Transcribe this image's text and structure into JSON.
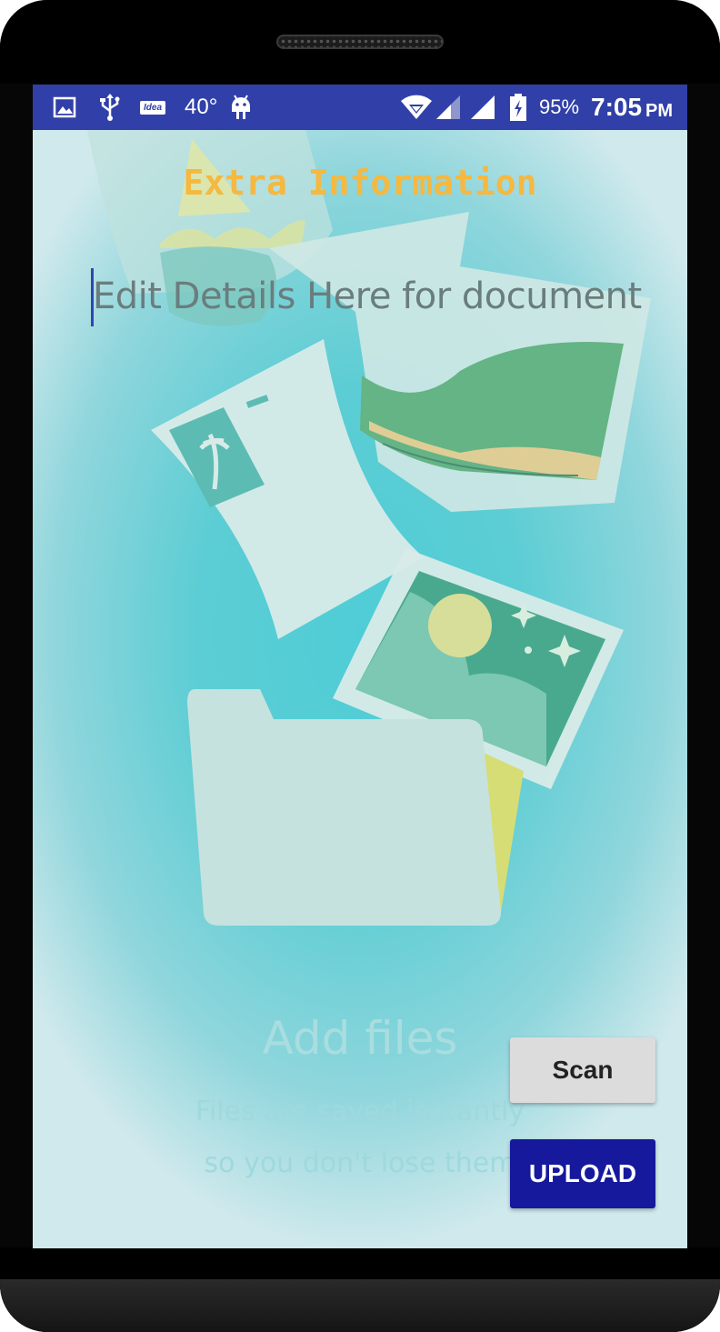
{
  "status_bar": {
    "temperature": "40°",
    "carrier_badge": "Idea",
    "battery_percent": "95%",
    "time": "7:05",
    "time_suffix": "PM",
    "icons": [
      "gallery-icon",
      "usb-icon",
      "idea-carrier-icon",
      "android-icon",
      "wifi-icon",
      "signal-icon",
      "signal-icon",
      "battery-charging-icon"
    ]
  },
  "screen": {
    "title": "Extra Information",
    "details_placeholder": "Edit Details Here for  document",
    "empty_state": {
      "title": "Add files",
      "subtitle_line1": "Files are saved instantly",
      "subtitle_line2": "so you don't lose them"
    },
    "scan_label": "Scan",
    "upload_label": "UPLOAD"
  },
  "colors": {
    "status_bar": "#3140a8",
    "title": "#f5b840",
    "upload_button": "#16199c",
    "scan_button": "#dcdcdc"
  }
}
